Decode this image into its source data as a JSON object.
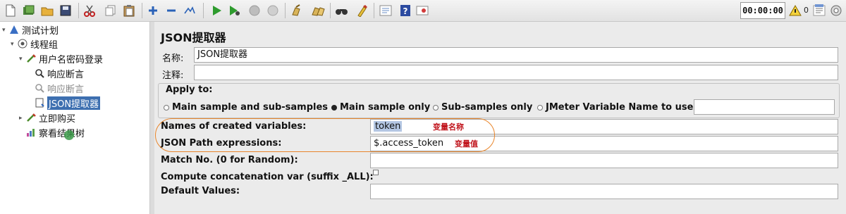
{
  "toolbar": {
    "timer": "00:00:00",
    "warning_count": "0",
    "icons": [
      "new-icon",
      "templates-icon",
      "open-icon",
      "save-icon",
      "cut-icon",
      "copy-icon",
      "paste-icon",
      "expand-icon",
      "collapse-icon",
      "toggle-icon",
      "start-icon",
      "start-no-pause-icon",
      "stop-icon",
      "shutdown-icon",
      "clear-icon",
      "clear-all-icon",
      "search-icon",
      "reset-search-icon",
      "function-helper-icon",
      "help-icon",
      "remote-icon",
      "warning-icon",
      "log-icon"
    ]
  },
  "tree": {
    "nodes": [
      {
        "label": "测试计划",
        "icon": "test-plan-icon"
      },
      {
        "label": "线程组",
        "icon": "thread-group-icon"
      },
      {
        "label": "用户名密码登录",
        "icon": "sampler-icon"
      },
      {
        "label": "响应断言",
        "icon": "assertion-icon"
      },
      {
        "label": "响应断言",
        "icon": "assertion-icon",
        "disabled": true
      },
      {
        "label": "JSON提取器",
        "icon": "extractor-icon",
        "selected": true
      },
      {
        "label": "立即购买",
        "icon": "sampler-icon"
      },
      {
        "label": "察看结果树",
        "icon": "listener-icon"
      }
    ]
  },
  "panel": {
    "title": "JSON提取器",
    "name_label": "名称:",
    "name_value": "JSON提取器",
    "comment_label": "注释:",
    "comment_value": "",
    "apply_to_label": "Apply to:",
    "apply_options": [
      {
        "label": "Main sample and sub-samples",
        "selected": false
      },
      {
        "label": "Main sample only",
        "selected": true
      },
      {
        "label": "Sub-samples only",
        "selected": false
      },
      {
        "label": "JMeter Variable Name to use",
        "selected": false
      }
    ],
    "jmeter_variable_value": "",
    "names_label": "Names of created variables:",
    "names_value": "token",
    "names_annotation": "变量名称",
    "json_path_label": "JSON Path expressions:",
    "json_path_value": "$.access_token",
    "json_path_annotation": "变量值",
    "match_no_label": "Match No. (0 for Random):",
    "match_no_value": "",
    "concat_label": "Compute concatenation var (suffix _ALL):",
    "concat_checked": false,
    "default_label": "Default Values:",
    "default_value": ""
  },
  "colors": {
    "selection": "#3d6fb0",
    "annotation": "#c0131b",
    "highlight_oval": "#e8852b"
  }
}
